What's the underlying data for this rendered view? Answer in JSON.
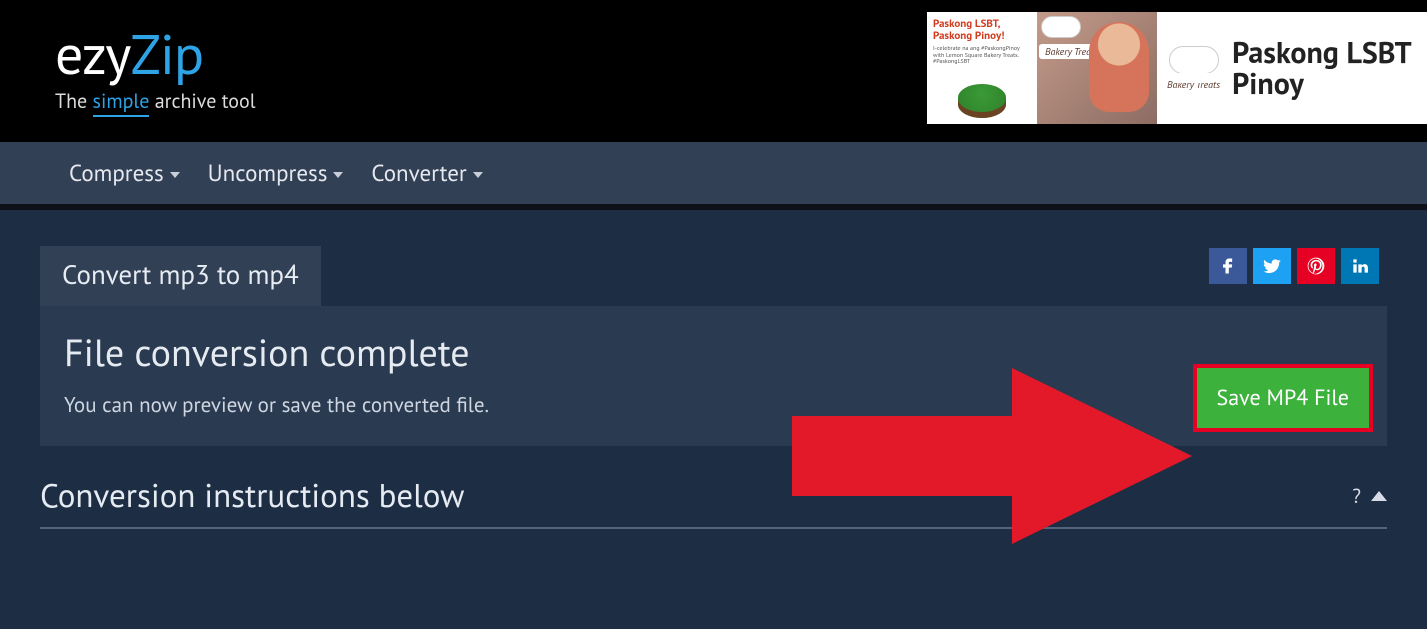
{
  "logo": {
    "part1": "ezy",
    "part2": "Zip",
    "tag_pre": "The ",
    "tag_simple": "simple",
    "tag_post": " archive tool"
  },
  "nav": {
    "compress": "Compress",
    "uncompress": "Uncompress",
    "converter": "Converter"
  },
  "tab": {
    "label": "Convert mp3 to mp4"
  },
  "panel": {
    "heading": "File conversion complete",
    "subtext": "You can now preview or save the converted file.",
    "save_button": "Save MP4 File"
  },
  "instructions": {
    "heading": "Conversion instructions below",
    "help": "?"
  },
  "ad": {
    "promo_line1": "Paskong LSBT,",
    "promo_line2": "Paskong Pinoy!",
    "promo_small": "I-celebrate na ang #PaskongPinoy with Lemon Square Bakery Treats. #PaskongLSBT",
    "ribbon": "Bakery Treats",
    "headline": "Paskong LSBT\nPinoy"
  }
}
